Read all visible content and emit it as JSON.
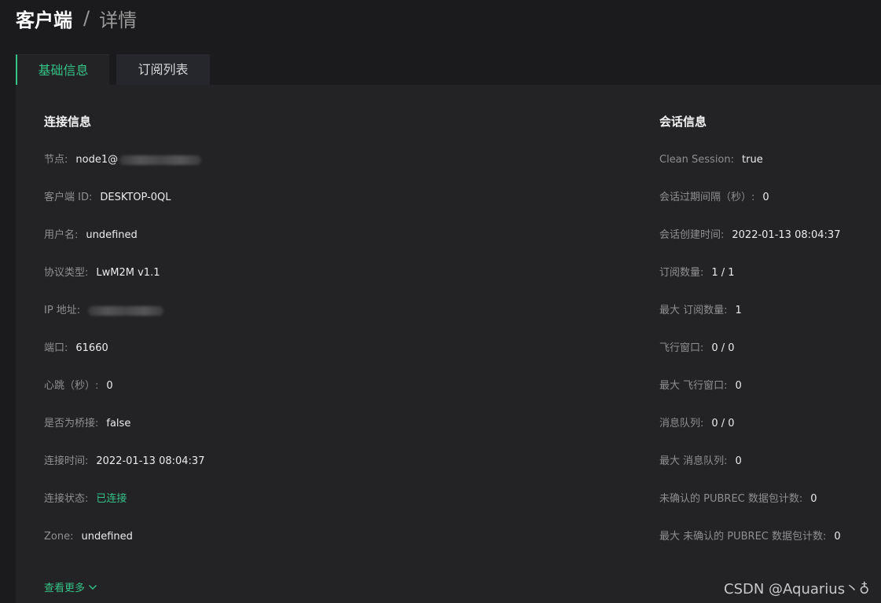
{
  "breadcrumb": {
    "main": "客户端",
    "separator": "/",
    "sub": "详情"
  },
  "tabs": [
    {
      "label": "基础信息",
      "active": true
    },
    {
      "label": "订阅列表",
      "active": false
    }
  ],
  "connection": {
    "title": "连接信息",
    "rows": [
      {
        "label": "节点:",
        "value": "node1@"
      },
      {
        "label": "客户端 ID:",
        "value": "DESKTOP-0QL"
      },
      {
        "label": "用户名:",
        "value": "undefined"
      },
      {
        "label": "协议类型:",
        "value": "LwM2M v1.1"
      },
      {
        "label": "IP 地址:",
        "value": ""
      },
      {
        "label": "端口:",
        "value": "61660"
      },
      {
        "label": "心跳（秒）:",
        "value": "0"
      },
      {
        "label": "是否为桥接:",
        "value": "false"
      },
      {
        "label": "连接时间:",
        "value": "2022-01-13 08:04:37"
      },
      {
        "label": "连接状态:",
        "value": "已连接"
      },
      {
        "label": "Zone:",
        "value": "undefined"
      }
    ]
  },
  "session": {
    "title": "会话信息",
    "rows": [
      {
        "label": "Clean Session:",
        "value": "true"
      },
      {
        "label": "会话过期间隔（秒）:",
        "value": "0"
      },
      {
        "label": "会话创建时间:",
        "value": "2022-01-13 08:04:37"
      },
      {
        "label": "订阅数量:",
        "value": "1 / 1"
      },
      {
        "label": "最大 订阅数量:",
        "value": "1"
      },
      {
        "label": "飞行窗口:",
        "value": "0 / 0"
      },
      {
        "label": "最大 飞行窗口:",
        "value": "0"
      },
      {
        "label": "消息队列:",
        "value": "0 / 0"
      },
      {
        "label": "最大 消息队列:",
        "value": "0"
      },
      {
        "label": "未确认的 PUBREC 数据包计数:",
        "value": "0"
      },
      {
        "label": "最大 未确认的 PUBREC 数据包计数:",
        "value": "0"
      }
    ]
  },
  "more_link": "查看更多",
  "watermark": "CSDN @Aquarius丶♁",
  "colors": {
    "accent": "#34c388",
    "background": "#1b1a1c",
    "panel": "#232225"
  },
  "icons": {
    "more": "chevron-down-icon"
  }
}
